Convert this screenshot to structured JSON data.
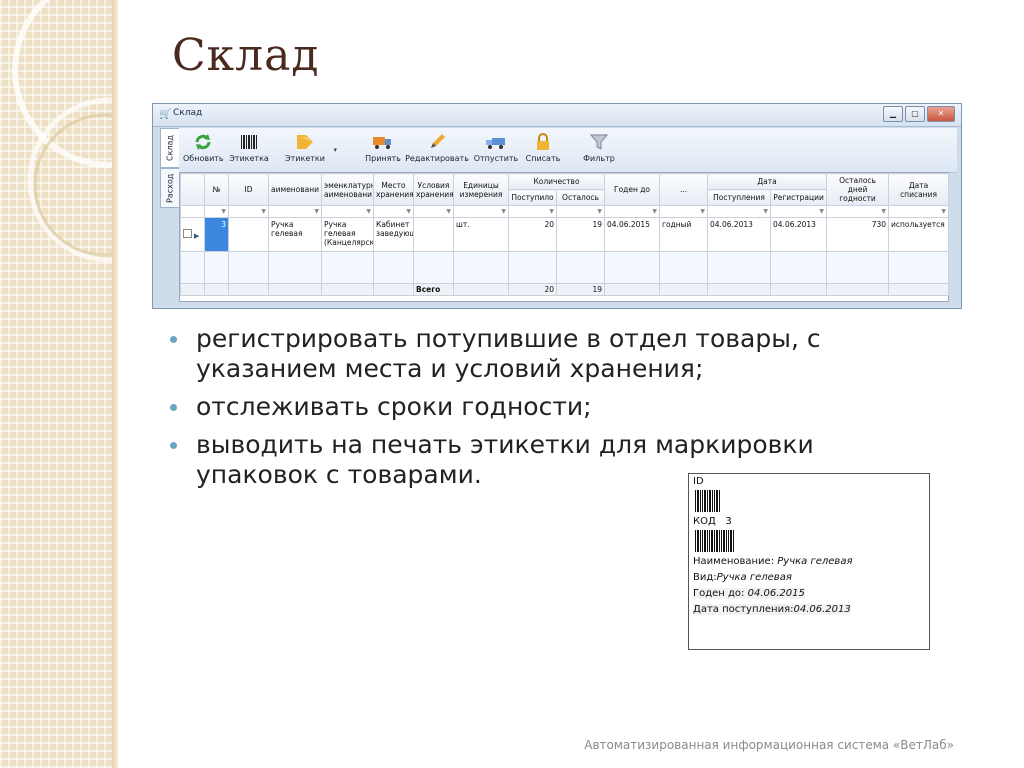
{
  "slide": {
    "title": "Склад",
    "footer": "Автоматизированная информационная система «ВетЛаб»",
    "accent_color": "#6aa6c0",
    "title_color": "#4a2a1f"
  },
  "window": {
    "title": "Склад",
    "side_tabs": [
      {
        "label": "Склад",
        "active": true
      },
      {
        "label": "Расход",
        "active": false
      }
    ],
    "toolbar": [
      {
        "label": "Обновить",
        "icon": "refresh-icon"
      },
      {
        "label": "Этикетка",
        "icon": "barcode-icon"
      },
      {
        "label": "Этикетки",
        "icon": "tag-icon"
      },
      {
        "label": "Принять",
        "icon": "truck-in-icon"
      },
      {
        "label": "Редактировать",
        "icon": "pencil-icon"
      },
      {
        "label": "Отпустить",
        "icon": "truck-out-icon"
      },
      {
        "label": "Списать",
        "icon": "lock-icon"
      },
      {
        "label": "Фильтр",
        "icon": "filter-icon"
      }
    ],
    "grid": {
      "headers": {
        "num": "№",
        "id": "ID",
        "name": "аименовани",
        "nomenclature": "эменклатурн аименовани",
        "place": "Место хранения",
        "conditions": "Условия хранения",
        "units": "Единицы измерения",
        "quantity": "Количество",
        "received": "Поступило",
        "remaining": "Осталось",
        "valid_until": "Годен до",
        "dots": "...",
        "date": "Дата",
        "date_received": "Поступления",
        "date_registered": "Регистрации",
        "days_left": "Осталось дней годности",
        "write_off": "Дата списания"
      },
      "row": {
        "num": "3",
        "id": "",
        "name": "Ручка гелевая",
        "nomenclature": "Ручка гелевая (Канцелярск",
        "place": "Кабинет заведующ",
        "conditions": "",
        "units": "шт.",
        "received": "20",
        "remaining": "19",
        "valid_until": "04.06.2015",
        "status": "годный",
        "date_received": "04.06.2013",
        "date_registered": "04.06.2013",
        "days_left": "730",
        "write_off": "используется"
      },
      "total": {
        "label": "Всего",
        "received": "20",
        "remaining": "19"
      }
    }
  },
  "bullets": [
    "регистрировать  потупившие в отдел товары, с указанием места и условий хранения;",
    "отслеживать сроки годности;",
    "выводить на печать этикетки для маркировки упаковок с товарами."
  ],
  "label_sample": {
    "id_label": "ID",
    "code_label": "КОД",
    "code_value": "3",
    "name_label": "Наименование:",
    "name_value": "Ручка гелевая",
    "kind_label": "Вид:",
    "kind_value": "Ручка гелевая",
    "valid_label": "Годен до:",
    "valid_value": "04.06.2015",
    "received_label": "Дата поступления:",
    "received_value": "04.06.2013"
  }
}
